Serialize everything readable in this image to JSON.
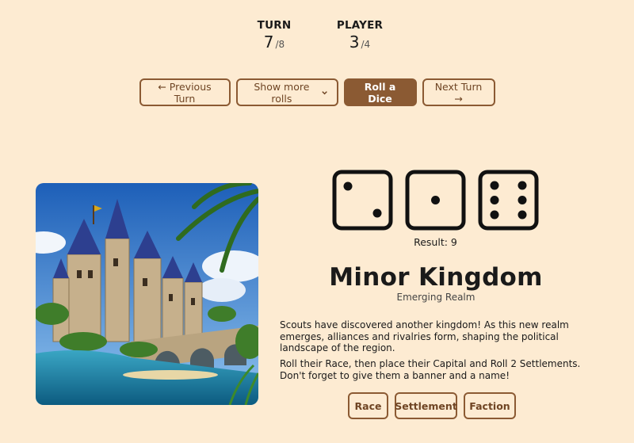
{
  "turn": {
    "label": "TURN",
    "value": "7",
    "total": "/8"
  },
  "player": {
    "label": "PLAYER",
    "value": "3",
    "total": "/4"
  },
  "toolbar": {
    "previous_turn": "← Previous Turn",
    "show_more_rolls": "Show more rolls",
    "roll_dice": "Roll a Dice",
    "next_turn": "Next Turn →"
  },
  "dice": {
    "values": [
      2,
      1,
      6
    ],
    "result": "Result: 9"
  },
  "card": {
    "title": "Minor Kingdom",
    "subtitle": "Emerging Realm",
    "paragraph1": "Scouts have discovered another kingdom! As this new realm emerges, alliances and rivalries form, shaping the political landscape of the region.",
    "paragraph2": "Roll their Race, then place their Capital and Roll 2 Settlements. Don't forget to give them a banner and a name!"
  },
  "actions": {
    "race": "Race",
    "settlement": "Settlement",
    "faction": "Faction"
  },
  "colors": {
    "background": "#fdebd2",
    "accent": "#8b5a33"
  },
  "icons": [
    "chevron-down-icon",
    "die-icon"
  ]
}
